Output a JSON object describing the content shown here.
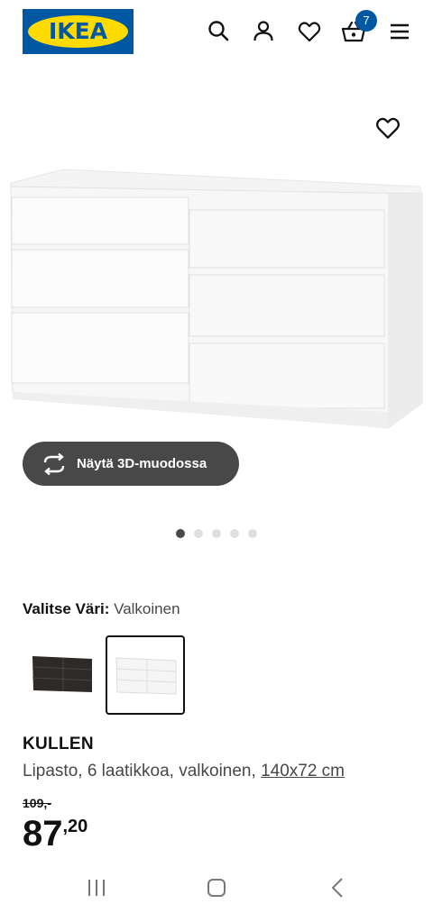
{
  "header": {
    "logo_text": "IKEA",
    "cart_count": "7",
    "icons": [
      "search-icon",
      "account-icon",
      "favourites-icon",
      "cart-icon",
      "menu-icon"
    ]
  },
  "gallery": {
    "view_3d_label": "Näytä 3D-muodossa",
    "slides_total": 5,
    "active_slide": 1
  },
  "color_selector": {
    "label": "Valitse Väri:",
    "selected": "Valkoinen",
    "options": [
      "black-brown",
      "white"
    ],
    "selected_index": 1
  },
  "product": {
    "name": "KULLEN",
    "description": "Lipasto, 6 laatikkoa, valkoinen,",
    "size_link": "140x72 cm",
    "old_price": "109,-",
    "price_integer": "87",
    "price_decimal": ",20"
  },
  "colors": {
    "brand_blue": "#0058a3",
    "brand_yellow": "#ffdb00",
    "button_dark": "#484848"
  }
}
